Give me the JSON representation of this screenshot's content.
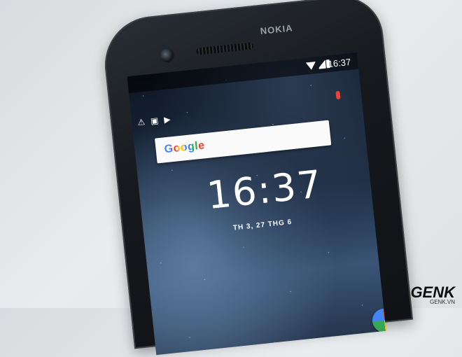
{
  "phone": {
    "brand": "NOKIA",
    "status_time": "16:37",
    "clock_time": "16:37",
    "date": "TH 3, 27 THG 6",
    "search_logo": "Google"
  },
  "watermark": {
    "logo": "GENK",
    "domain": "GENK.VN"
  },
  "colors": {
    "google_blue": "#4285f4",
    "google_red": "#ea4335",
    "google_yellow": "#fbbc05",
    "google_green": "#34a853"
  }
}
